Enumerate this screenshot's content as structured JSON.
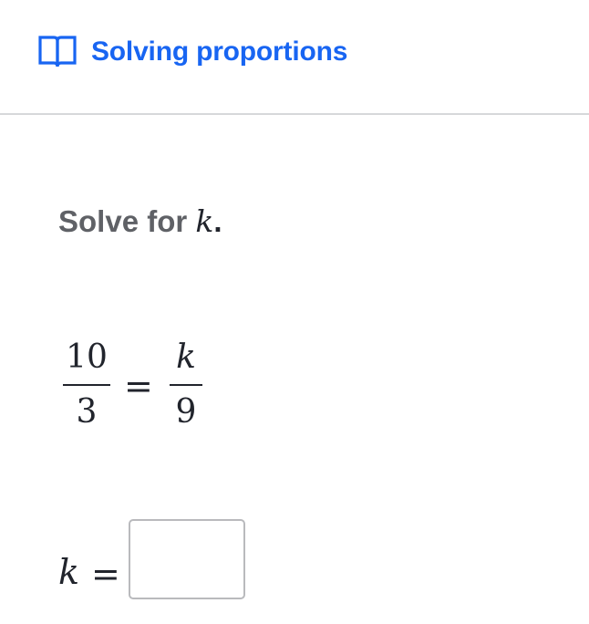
{
  "header": {
    "icon": "book-open-icon",
    "title": "Solving proportions",
    "accent_color": "#1865f2"
  },
  "question": {
    "prompt_text": "Solve for",
    "variable": "k",
    "period": "."
  },
  "equation": {
    "left_numerator": "10",
    "left_denominator": "3",
    "operator": "=",
    "right_numerator": "k",
    "right_denominator": "9"
  },
  "answer": {
    "variable": "k",
    "operator": "=",
    "value": "",
    "placeholder": ""
  }
}
